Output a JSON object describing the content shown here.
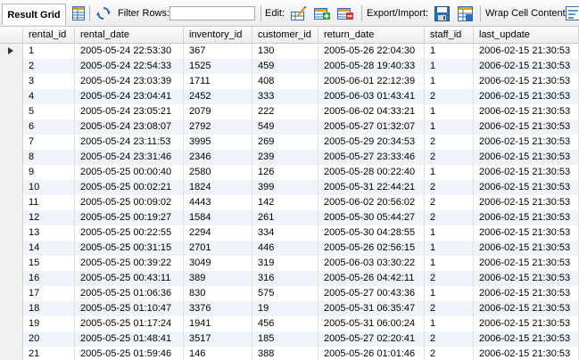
{
  "toolbar": {
    "result_grid_label": "Result Grid",
    "filter_rows_label": "Filter Rows:",
    "filter_value": "",
    "edit_label": "Edit:",
    "export_import_label": "Export/Import:",
    "wrap_label": "Wrap Cell Content:",
    "icons": [
      "grid-view-icon",
      "refresh-icon",
      "edit-cell-icon",
      "add-row-icon",
      "delete-row-icon",
      "export-icon",
      "import-icon",
      "wrap-cell-icon"
    ]
  },
  "grid": {
    "columns": [
      "rental_id",
      "rental_date",
      "inventory_id",
      "customer_id",
      "return_date",
      "staff_id",
      "last_update"
    ],
    "rows": [
      [
        "1",
        "2005-05-24 22:53:30",
        "367",
        "130",
        "2005-05-26 22:04:30",
        "1",
        "2006-02-15 21:30:53"
      ],
      [
        "2",
        "2005-05-24 22:54:33",
        "1525",
        "459",
        "2005-05-28 19:40:33",
        "1",
        "2006-02-15 21:30:53"
      ],
      [
        "3",
        "2005-05-24 23:03:39",
        "1711",
        "408",
        "2005-06-01 22:12:39",
        "1",
        "2006-02-15 21:30:53"
      ],
      [
        "4",
        "2005-05-24 23:04:41",
        "2452",
        "333",
        "2005-06-03 01:43:41",
        "2",
        "2006-02-15 21:30:53"
      ],
      [
        "5",
        "2005-05-24 23:05:21",
        "2079",
        "222",
        "2005-06-02 04:33:21",
        "1",
        "2006-02-15 21:30:53"
      ],
      [
        "6",
        "2005-05-24 23:08:07",
        "2792",
        "549",
        "2005-05-27 01:32:07",
        "1",
        "2006-02-15 21:30:53"
      ],
      [
        "7",
        "2005-05-24 23:11:53",
        "3995",
        "269",
        "2005-05-29 20:34:53",
        "2",
        "2006-02-15 21:30:53"
      ],
      [
        "8",
        "2005-05-24 23:31:46",
        "2346",
        "239",
        "2005-05-27 23:33:46",
        "2",
        "2006-02-15 21:30:53"
      ],
      [
        "9",
        "2005-05-25 00:00:40",
        "2580",
        "126",
        "2005-05-28 00:22:40",
        "1",
        "2006-02-15 21:30:53"
      ],
      [
        "10",
        "2005-05-25 00:02:21",
        "1824",
        "399",
        "2005-05-31 22:44:21",
        "2",
        "2006-02-15 21:30:53"
      ],
      [
        "11",
        "2005-05-25 00:09:02",
        "4443",
        "142",
        "2005-06-02 20:56:02",
        "2",
        "2006-02-15 21:30:53"
      ],
      [
        "12",
        "2005-05-25 00:19:27",
        "1584",
        "261",
        "2005-05-30 05:44:27",
        "2",
        "2006-02-15 21:30:53"
      ],
      [
        "13",
        "2005-05-25 00:22:55",
        "2294",
        "334",
        "2005-05-30 04:28:55",
        "1",
        "2006-02-15 21:30:53"
      ],
      [
        "14",
        "2005-05-25 00:31:15",
        "2701",
        "446",
        "2005-05-26 02:56:15",
        "1",
        "2006-02-15 21:30:53"
      ],
      [
        "15",
        "2005-05-25 00:39:22",
        "3049",
        "319",
        "2005-06-03 03:30:22",
        "1",
        "2006-02-15 21:30:53"
      ],
      [
        "16",
        "2005-05-25 00:43:11",
        "389",
        "316",
        "2005-05-26 04:42:11",
        "2",
        "2006-02-15 21:30:53"
      ],
      [
        "17",
        "2005-05-25 01:06:36",
        "830",
        "575",
        "2005-05-27 00:43:36",
        "1",
        "2006-02-15 21:30:53"
      ],
      [
        "18",
        "2005-05-25 01:10:47",
        "3376",
        "19",
        "2005-05-31 06:35:47",
        "2",
        "2006-02-15 21:30:53"
      ],
      [
        "19",
        "2005-05-25 01:17:24",
        "1941",
        "456",
        "2005-05-31 06:00:24",
        "1",
        "2006-02-15 21:30:53"
      ],
      [
        "20",
        "2005-05-25 01:48:41",
        "3517",
        "185",
        "2005-05-27 02:20:41",
        "2",
        "2006-02-15 21:30:53"
      ],
      [
        "21",
        "2005-05-25 01:59:46",
        "146",
        "388",
        "2005-05-26 01:01:46",
        "2",
        "2006-02-15 21:30:53"
      ]
    ],
    "current_row": 0
  },
  "colors": {
    "alt_row": "#eef4fa",
    "icon_blue": "#2f6fb6",
    "icon_orange": "#e89a2c",
    "icon_green": "#3a9a3a",
    "icon_red": "#d23a2a"
  }
}
